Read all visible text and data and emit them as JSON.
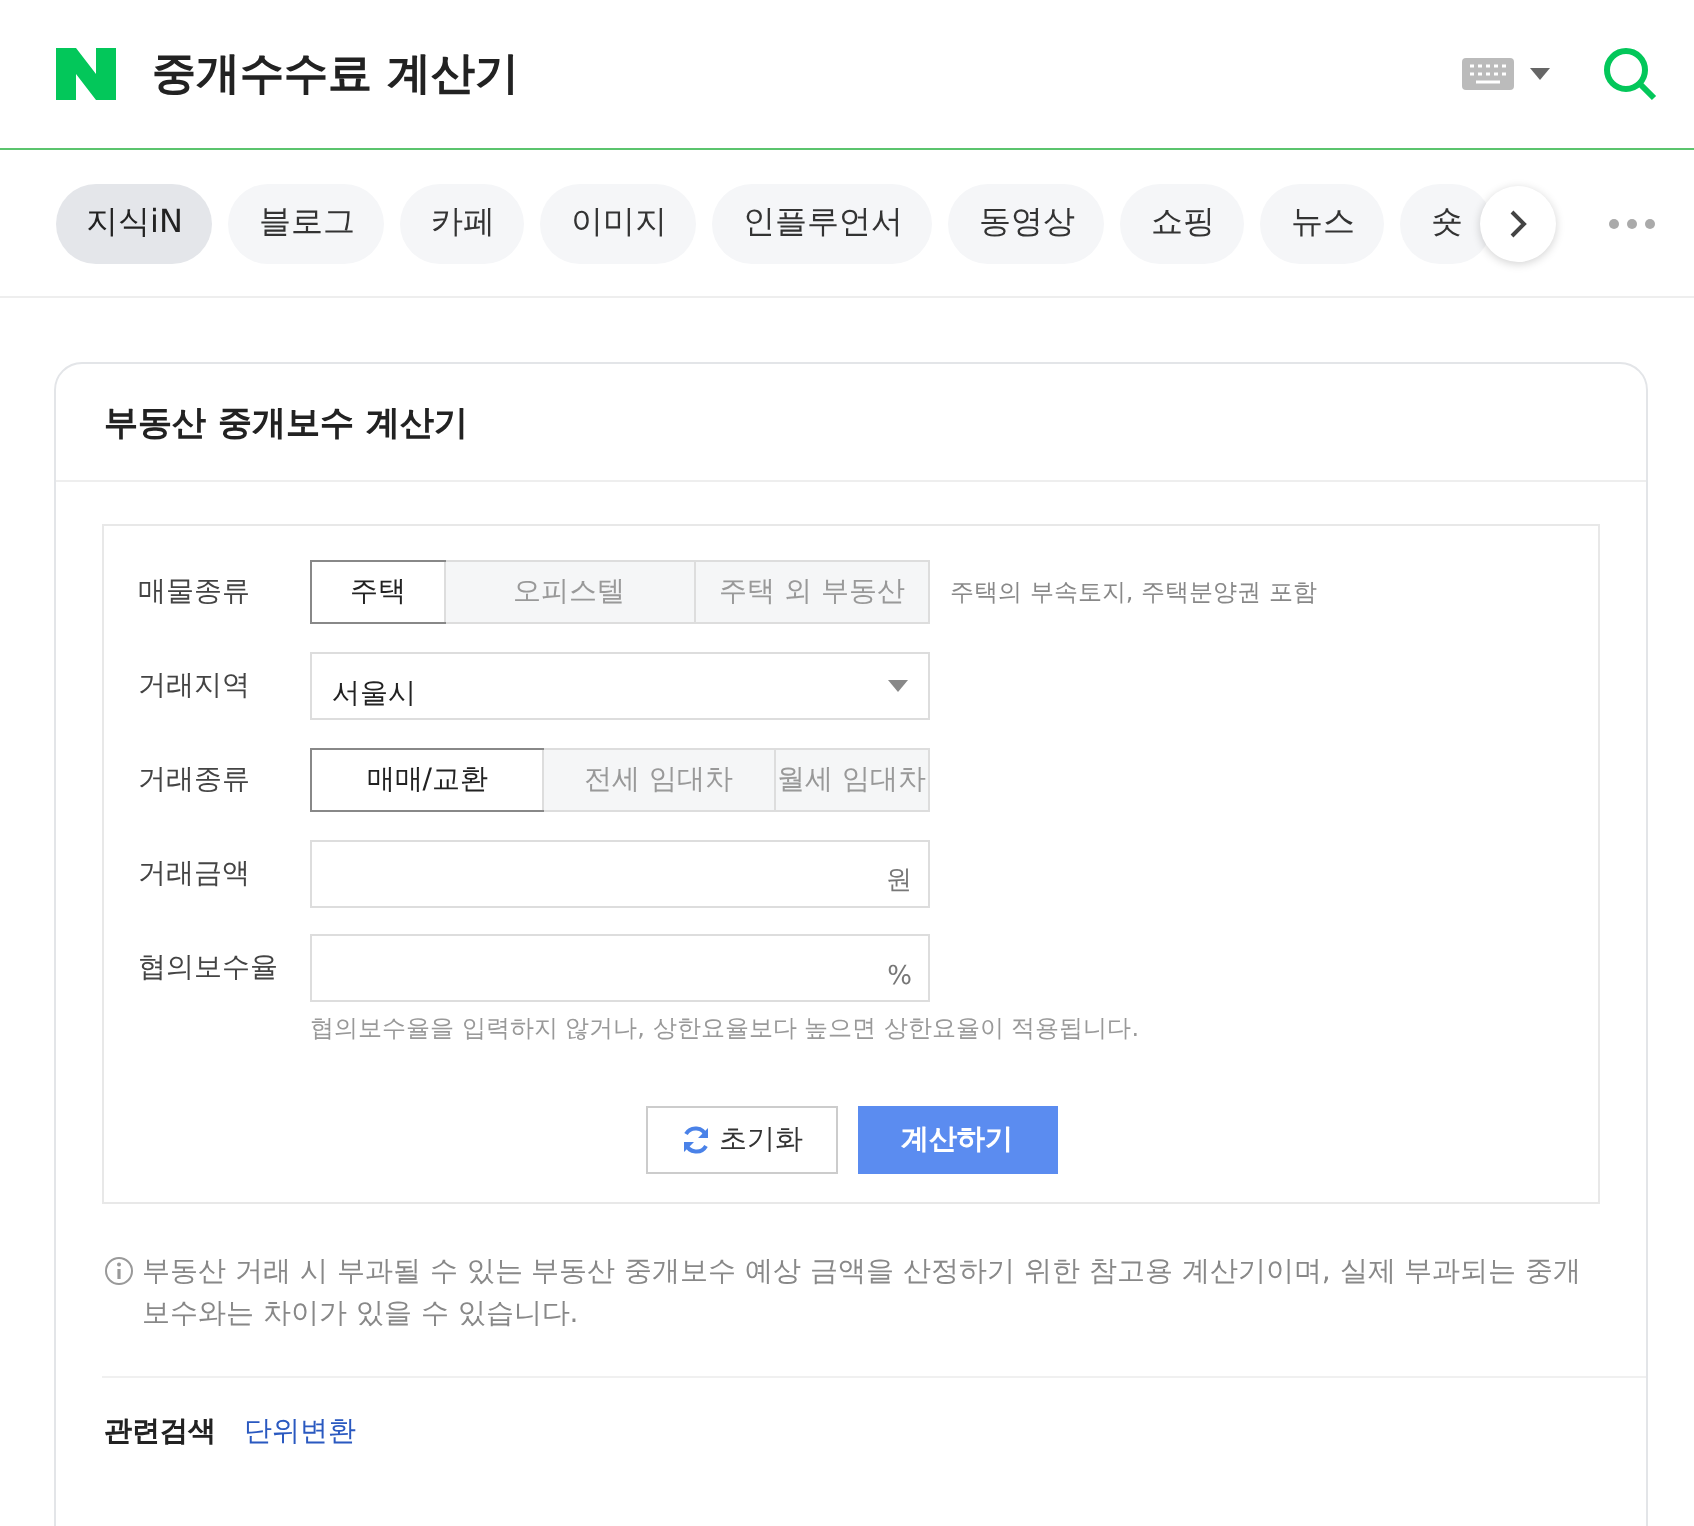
{
  "header": {
    "query": "중개수수료 계산기"
  },
  "tabs": [
    {
      "label": "지식iN",
      "selected": true
    },
    {
      "label": "블로그",
      "selected": false
    },
    {
      "label": "카페",
      "selected": false
    },
    {
      "label": "이미지",
      "selected": false
    },
    {
      "label": "인플루언서",
      "selected": false
    },
    {
      "label": "동영상",
      "selected": false
    },
    {
      "label": "쇼핑",
      "selected": false
    },
    {
      "label": "뉴스",
      "selected": false
    },
    {
      "label": "숏",
      "selected": false
    }
  ],
  "card": {
    "title": "부동산 중개보수 계산기"
  },
  "form": {
    "property_type": {
      "label": "매물종류",
      "options": [
        {
          "label": "주택",
          "selected": true
        },
        {
          "label": "오피스텔",
          "selected": false
        },
        {
          "label": "주택 외 부동산",
          "selected": false
        }
      ],
      "note": "주택의 부속토지, 주택분양권 포함"
    },
    "region": {
      "label": "거래지역",
      "value": "서울시"
    },
    "deal_type": {
      "label": "거래종류",
      "options": [
        {
          "label": "매매/교환",
          "selected": true
        },
        {
          "label": "전세 임대차",
          "selected": false
        },
        {
          "label": "월세 임대차",
          "selected": false
        }
      ]
    },
    "amount": {
      "label": "거래금액",
      "unit": "원"
    },
    "rate": {
      "label": "협의보수율",
      "unit": "%",
      "hint": "협의보수율을 입력하지 않거나, 상한요율보다 높으면 상한요율이 적용됩니다."
    },
    "reset_button": "초기화",
    "calc_button": "계산하기"
  },
  "notice": "부동산 거래 시 부과될 수 있는 부동산 중개보수 예상 금액을 산정하기 위한 참고용 계산기이며, 실제 부과되는 중개보수와는 차이가 있을 수 있습니다.",
  "related": {
    "label": "관련검색",
    "links": [
      "단위변환"
    ]
  }
}
